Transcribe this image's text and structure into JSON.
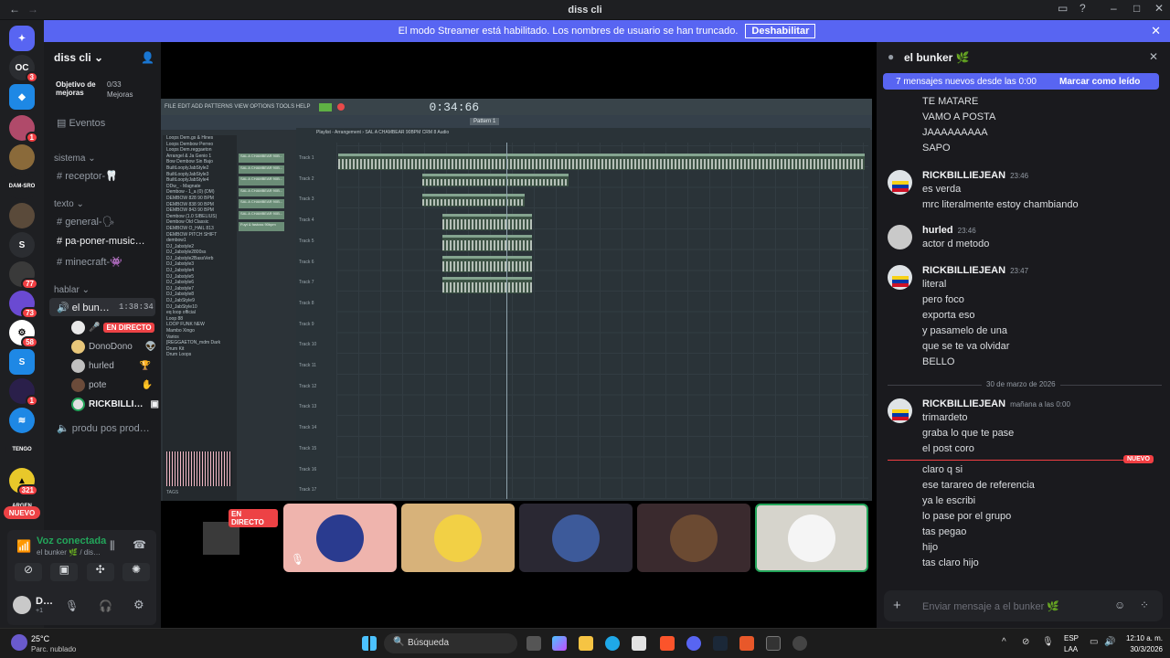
{
  "window": {
    "title": "diss cli"
  },
  "banner": {
    "text": "El modo Streamer está habilitado. Los nombres de usuario se han truncado.",
    "button": "Deshabilitar"
  },
  "guild_badges": {
    "b1": "3",
    "b2": "1",
    "b3": "1",
    "dam": "DAM-SRO",
    "s": "S",
    "b77": "77",
    "b73": "73",
    "b58": "58",
    "b1b": "1",
    "b321": "321",
    "argen": "ARGEN",
    "nuevo": "NUEVO",
    "tengo": "TENGO"
  },
  "server": {
    "name": "diss cli",
    "boost_label": "Objetivo de mejoras",
    "boost_count": "0/33",
    "boost_sub": "Mejoras",
    "events": "Eventos"
  },
  "channels": {
    "cat_sistema": "sistema",
    "receptor": "receptor-🦷",
    "cat_texto": "texto",
    "general": "general-🗣",
    "paponer": "pa-poner-music…",
    "minecraft": "minecraft-👾",
    "cat_hablar": "hablar",
    "bunker": "el bun…",
    "bunker_time": "1:38:34",
    "produ": "produ pos prod…"
  },
  "voice_users": [
    {
      "name": "",
      "live": "EN DIRECTO",
      "color": "#e9e9e9"
    },
    {
      "name": "DonoDono",
      "color": "#e8c77a"
    },
    {
      "name": "hurled",
      "color": "#c0c0c0"
    },
    {
      "name": "pote",
      "color": "#6b4b3a"
    },
    {
      "name": "RICKBILLI…",
      "color": "#e0e0e0"
    }
  ],
  "voice_panel": {
    "status": "Voz conectada",
    "sub": "el bunker 🌿 / dis…",
    "user": "D…",
    "user_sub": "+1"
  },
  "fl": {
    "menu": "FILE EDIT ADD PATTERNS VIEW OPTIONS TOOLS HELP",
    "time": "0:34:66",
    "pattern": "Pattern 1",
    "playlist_title": "Playlist - Arrangement › SAL A CHAMBEAR 90BPM CRM 8 Audio",
    "tracks": [
      "Track 1",
      "Track 2",
      "Track 3",
      "Track 4",
      "Track 5",
      "Track 6",
      "Track 7",
      "Track 8",
      "Track 9",
      "Track 10",
      "Track 11",
      "Track 12",
      "Track 13",
      "Track 14",
      "Track 15",
      "Track 16",
      "Track 17"
    ],
    "browser": [
      "Loops Dem.gs & Hines",
      "Loops Dembow Perreo",
      "Loops Dem.reggaeton",
      "Arrangel & Ja Genio 1",
      "Bow Dembow Sin Bajo",
      "BuiltLooplyJabStyle2",
      "BuiltLooplyJabStyle3",
      "BuiltLooplyJabStyle4",
      "DDw_ - Magnate",
      "Dembow - 1_a (0) (DM)",
      "DEMBOW 828 90 BPM",
      "DEMBOW 838 90 BPM",
      "DEMBOW 843 90 BPM",
      "Dembow (1.0 SIBELIUS)",
      "Dembow Old Classic",
      "DEMBOW O_HAIL 813",
      "DEMBOW PITCH SHIFT",
      "dembow1",
      "DJ_Jabstyle2",
      "DJ_Jabstyle2800ss",
      "DJ_Jabstyle2BassVerb",
      "DJ_Jabstyle3",
      "DJ_Jabstyle4",
      "DJ_Jabstyle5",
      "DJ_Jabstyle6",
      "DJ_Jabstyle7",
      "DJ_Jabstyle8",
      "DJ_JabStyle9",
      "DJ_JabStyle10",
      "eq loop official",
      "Loop 88",
      "LOOP FUNK NEW",
      "Mambo Xingo",
      "Varios",
      "[REGGAETON_mdm Dark",
      "Drum Kit",
      "Drum Loops"
    ],
    "rack": [
      "SAL A CHAMBEAR 90B...",
      "SAL A CHAMBEAR 90B...",
      "SAL A CHAMBEAR 90B...",
      "SAL A CHAMBEAR 90B...",
      "SAL A CHAMBEAR 90B...",
      "SAL A CHAMBEAR 90B...",
      "Fuyt & fastoss 90bpm"
    ],
    "tags": "TAGS"
  },
  "tiles": {
    "live": "EN DIRECTO"
  },
  "chat": {
    "channel": "el bunker 🌿",
    "new_messages": "7 mensajes nuevos desde las 0:00",
    "mark_read": "Marcar como leído",
    "date_divider": "30 de marzo de 2026",
    "new_tag": "NUEVO",
    "placeholder": "Enviar mensaje a el bunker 🌿",
    "lines": {
      "m0": "TE MATARE",
      "m1": "VAMO A POSTA",
      "m2": "JAAAAAAAAA",
      "m3": "SAPO",
      "a1": "RICKBILLIEJEAN",
      "t1": "23:46",
      "m4": "es verda",
      "m5": "mrc literalmente estoy chambiando",
      "a2": "hurled",
      "t2": "23:46",
      "m6": "actor d metodo",
      "a3": "RICKBILLIEJEAN",
      "t3": "23:47",
      "m7": "literal",
      "m8": "pero foco",
      "m9": "exporta eso",
      "m10": "y pasamelo de una",
      "m11": "que se te va olvidar",
      "m12": "BELLO",
      "a4": "RICKBILLIEJEAN",
      "t4": "mañana a las 0:00",
      "m13": "trimardeto",
      "m14": "graba lo que te pase",
      "m15": "el post coro",
      "m16": "claro q si",
      "m17": "ese tarareo de referencia",
      "m18": "ya le escribi",
      "m19": "lo pase por el  grupo",
      "m20": "tas pegao",
      "m21": "hijo",
      "m22": "tas claro hijo"
    }
  },
  "taskbar": {
    "temp": "25°C",
    "weather": "Parc. nublado",
    "search": "Búsqueda",
    "lang1": "ESP",
    "lang2": "LAA",
    "time": "12:10 a. m.",
    "date": "30/3/2026"
  }
}
